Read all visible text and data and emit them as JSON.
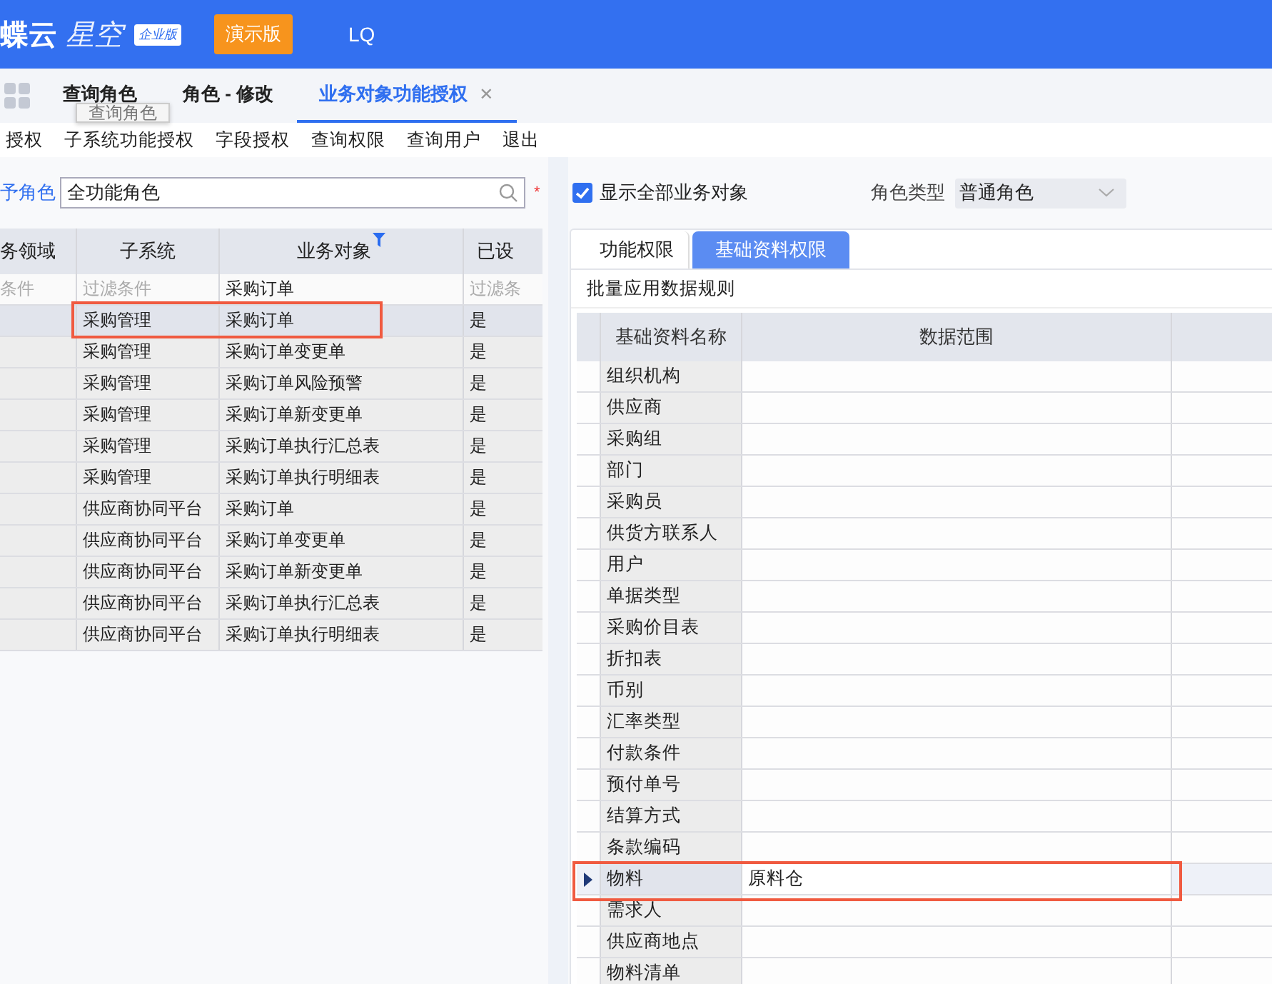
{
  "header": {
    "logo_main": "蝶云",
    "logo_sub": "星空",
    "edition": "企业版",
    "demo_badge": "演示版",
    "user": "LQ"
  },
  "tabs": [
    {
      "label": "查询角色",
      "selected": false,
      "closable": false
    },
    {
      "label": "角色 - 修改",
      "selected": false,
      "closable": false
    },
    {
      "label": "业务对象功能授权",
      "selected": true,
      "closable": true
    }
  ],
  "close_glyph": "✕",
  "tooltip": "查询角色",
  "toolbar": [
    "授权",
    "子系统功能授权",
    "字段授权",
    "查询权限",
    "查询用户",
    "退出"
  ],
  "role_field": {
    "label": "予角色",
    "value": "全功能角色",
    "required": "*"
  },
  "left_table": {
    "columns": [
      {
        "label": "务领域",
        "filtered": false
      },
      {
        "label": "子系统",
        "filtered": false
      },
      {
        "label": "业务对象",
        "filtered": true
      },
      {
        "label": "已设",
        "filtered": false
      }
    ],
    "filters": [
      "条件",
      "过滤条件",
      "采购订单",
      "过滤条"
    ],
    "rows": [
      {
        "cells": [
          "",
          "采购管理",
          "采购订单",
          "是"
        ],
        "selected": true,
        "highlighted": true
      },
      {
        "cells": [
          "",
          "采购管理",
          "采购订单变更单",
          "是"
        ],
        "selected": false,
        "highlighted": false
      },
      {
        "cells": [
          "",
          "采购管理",
          "采购订单风险预警",
          "是"
        ],
        "selected": false,
        "highlighted": false
      },
      {
        "cells": [
          "",
          "采购管理",
          "采购订单新变更单",
          "是"
        ],
        "selected": false,
        "highlighted": false
      },
      {
        "cells": [
          "",
          "采购管理",
          "采购订单执行汇总表",
          "是"
        ],
        "selected": false,
        "highlighted": false
      },
      {
        "cells": [
          "",
          "采购管理",
          "采购订单执行明细表",
          "是"
        ],
        "selected": false,
        "highlighted": false
      },
      {
        "cells": [
          "",
          "供应商协同平台",
          "采购订单",
          "是"
        ],
        "selected": false,
        "highlighted": false
      },
      {
        "cells": [
          "",
          "供应商协同平台",
          "采购订单变更单",
          "是"
        ],
        "selected": false,
        "highlighted": false
      },
      {
        "cells": [
          "",
          "供应商协同平台",
          "采购订单新变更单",
          "是"
        ],
        "selected": false,
        "highlighted": false
      },
      {
        "cells": [
          "",
          "供应商协同平台",
          "采购订单执行汇总表",
          "是"
        ],
        "selected": false,
        "highlighted": false
      },
      {
        "cells": [
          "",
          "供应商协同平台",
          "采购订单执行明细表",
          "是"
        ],
        "selected": false,
        "highlighted": false
      }
    ]
  },
  "show_all": {
    "label": "显示全部业务对象",
    "checked": true
  },
  "role_type": {
    "label": "角色类型",
    "value": "普通角色"
  },
  "inner_tabs": [
    {
      "label": "功能权限",
      "selected": false
    },
    {
      "label": "基础资料权限",
      "selected": true
    }
  ],
  "batch_link": "批量应用数据规则",
  "data_grid": {
    "columns": [
      "基础资料名称",
      "数据范围"
    ],
    "rows": [
      {
        "name": "组织机构",
        "value": "",
        "selected": false,
        "highlighted": false
      },
      {
        "name": "供应商",
        "value": "",
        "selected": false,
        "highlighted": false
      },
      {
        "name": "采购组",
        "value": "",
        "selected": false,
        "highlighted": false
      },
      {
        "name": "部门",
        "value": "",
        "selected": false,
        "highlighted": false
      },
      {
        "name": "采购员",
        "value": "",
        "selected": false,
        "highlighted": false
      },
      {
        "name": "供货方联系人",
        "value": "",
        "selected": false,
        "highlighted": false
      },
      {
        "name": "用户",
        "value": "",
        "selected": false,
        "highlighted": false
      },
      {
        "name": "单据类型",
        "value": "",
        "selected": false,
        "highlighted": false
      },
      {
        "name": "采购价目表",
        "value": "",
        "selected": false,
        "highlighted": false
      },
      {
        "name": "折扣表",
        "value": "",
        "selected": false,
        "highlighted": false
      },
      {
        "name": "币别",
        "value": "",
        "selected": false,
        "highlighted": false
      },
      {
        "name": "汇率类型",
        "value": "",
        "selected": false,
        "highlighted": false
      },
      {
        "name": "付款条件",
        "value": "",
        "selected": false,
        "highlighted": false
      },
      {
        "name": "预付单号",
        "value": "",
        "selected": false,
        "highlighted": false
      },
      {
        "name": "结算方式",
        "value": "",
        "selected": false,
        "highlighted": false
      },
      {
        "name": "条款编码",
        "value": "",
        "selected": false,
        "highlighted": false
      },
      {
        "name": "物料",
        "value": "原料仓",
        "selected": true,
        "highlighted": true
      },
      {
        "name": "需求人",
        "value": "",
        "selected": false,
        "highlighted": false
      },
      {
        "name": "供应商地点",
        "value": "",
        "selected": false,
        "highlighted": false
      },
      {
        "name": "物料清单",
        "value": "",
        "selected": false,
        "highlighted": false
      }
    ]
  }
}
